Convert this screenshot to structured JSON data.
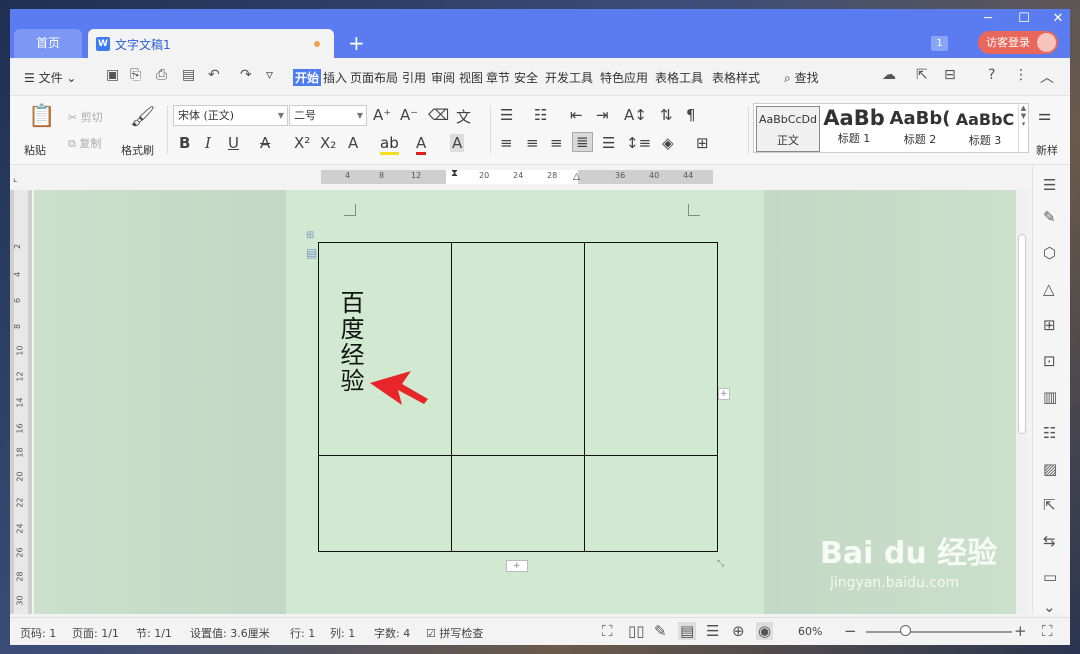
{
  "tabs": {
    "home": "首页",
    "doc": "文字文稿1",
    "add": "+"
  },
  "window": {
    "badge": "1",
    "login": "访客登录"
  },
  "menu": {
    "file": "文件",
    "items": [
      "开始",
      "插入",
      "页面布局",
      "引用",
      "审阅",
      "视图",
      "章节",
      "安全",
      "开发工具",
      "特色应用",
      "表格工具",
      "表格样式"
    ],
    "active": "开始",
    "search": "查找"
  },
  "ribbon": {
    "paste": "粘贴",
    "cut": "剪切",
    "copy": "复制",
    "format_painter": "格式刷",
    "font_name": "宋体 (正文)",
    "font_size": "二号",
    "styles": [
      {
        "preview": "AaBbCcDd",
        "label": "正文"
      },
      {
        "preview": "AaBb",
        "label": "标题 1"
      },
      {
        "preview": "AaBb(",
        "label": "标题 2"
      },
      {
        "preview": "AaBbC",
        "label": "标题 3"
      }
    ],
    "new_style": "新样"
  },
  "ruler": {
    "h_numbers": [
      "4",
      "8",
      "12",
      "20",
      "24",
      "28",
      "36",
      "40",
      "44"
    ],
    "v_numbers": [
      "2",
      "4",
      "6",
      "8",
      "10",
      "12",
      "14",
      "16",
      "18",
      "20",
      "22",
      "24",
      "26",
      "28",
      "30"
    ]
  },
  "document": {
    "cell_text": "百度经验"
  },
  "status": {
    "page_code": "页码: 1",
    "page": "页面: 1/1",
    "section": "节: 1/1",
    "setting": "设置值: 3.6厘米",
    "row": "行: 1",
    "col": "列: 1",
    "words": "字数: 4",
    "spell": "拼写检查",
    "zoom": "60%"
  },
  "watermark": {
    "brand": "Bai du 经验",
    "url": "jingyan.baidu.com"
  },
  "colors": {
    "titlebar": "#5a7cf0",
    "accent": "#4d7cf0",
    "login": "#e8675a",
    "page_bg": "#d1e8d1",
    "arrow": "#e8262a"
  }
}
